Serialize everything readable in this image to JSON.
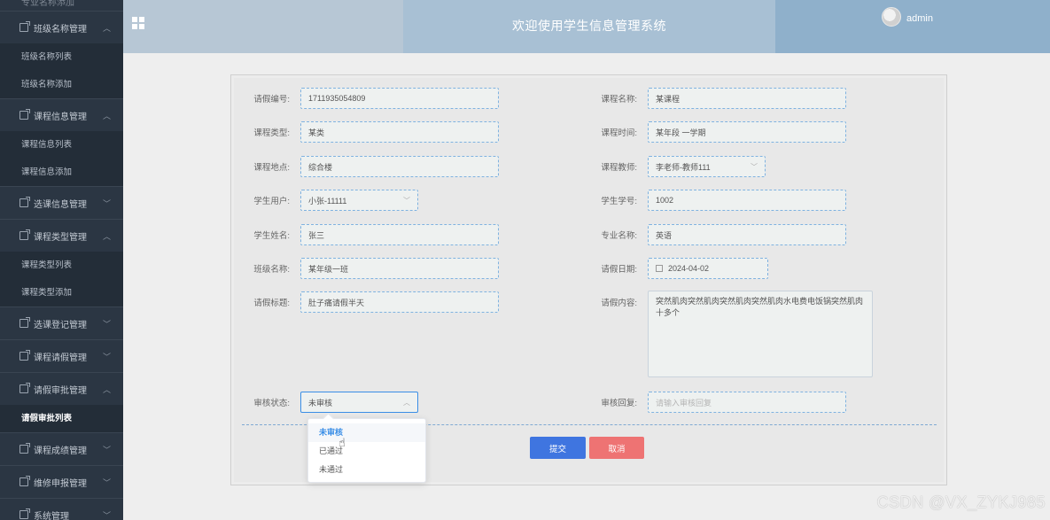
{
  "header": {
    "title": "欢迎使用学生信息管理系统",
    "username": "admin"
  },
  "sidebar": {
    "top_cut": "专业名称添加",
    "sections": [
      {
        "label": "班级名称管理",
        "chevron": "up",
        "subs": [
          "班级名称列表",
          "班级名称添加"
        ]
      },
      {
        "label": "课程信息管理",
        "chevron": "up",
        "subs": [
          "课程信息列表",
          "课程信息添加"
        ]
      },
      {
        "label": "选课信息管理",
        "chevron": "down",
        "subs": []
      },
      {
        "label": "课程类型管理",
        "chevron": "up",
        "subs": [
          "课程类型列表",
          "课程类型添加"
        ]
      },
      {
        "label": "选课登记管理",
        "chevron": "down",
        "subs": []
      },
      {
        "label": "课程请假管理",
        "chevron": "down",
        "subs": []
      },
      {
        "label": "请假审批管理",
        "chevron": "up",
        "subs": [
          "请假审批列表"
        ]
      },
      {
        "label": "课程成绩管理",
        "chevron": "down",
        "subs": []
      },
      {
        "label": "维修申报管理",
        "chevron": "down",
        "subs": []
      },
      {
        "label": "系统管理",
        "chevron": "down",
        "subs": []
      }
    ]
  },
  "form": {
    "leave_no": {
      "label": "请假编号:",
      "value": "1711935054809"
    },
    "course_name": {
      "label": "课程名称:",
      "value": "某课程"
    },
    "course_type": {
      "label": "课程类型:",
      "value": "某类"
    },
    "course_time": {
      "label": "课程时间:",
      "value": "某年段 一学期"
    },
    "course_place": {
      "label": "课程地点:",
      "value": "综合楼"
    },
    "course_teacher": {
      "label": "课程教师:",
      "value": "李老师-教师111"
    },
    "student_user": {
      "label": "学生用户:",
      "value": "小张-11111"
    },
    "student_no": {
      "label": "学生学号:",
      "value": "1002"
    },
    "student_name": {
      "label": "学生姓名:",
      "value": "张三"
    },
    "major_name": {
      "label": "专业名称:",
      "value": "英语"
    },
    "class_name": {
      "label": "班级名称:",
      "value": "某年级一班"
    },
    "leave_date": {
      "label": "请假日期:",
      "value": "2024-04-02"
    },
    "leave_title": {
      "label": "请假标题:",
      "value": "肚子痛请假半天"
    },
    "leave_content": {
      "label": "请假内容:",
      "value": "突然肌肉突然肌肉突然肌肉突然肌肉水电费电饭锅突然肌肉十多个"
    },
    "review_status": {
      "label": "审核状态:",
      "value": "未审核"
    },
    "review_reply": {
      "label": "审核回复:",
      "placeholder": "请输入审核回复"
    },
    "submit_label": "提交",
    "cancel_label": "取消"
  },
  "dropdown": {
    "options": [
      "未审核",
      "已通过",
      "未通过"
    ],
    "selected": "未审核"
  },
  "watermark": "CSDN @VX_ZYKJ985",
  "colors": {
    "sidebar_bg": "#2b3643",
    "header_bg": "#b7c7d5",
    "primary": "#3f75e0",
    "danger": "#ee7373"
  }
}
